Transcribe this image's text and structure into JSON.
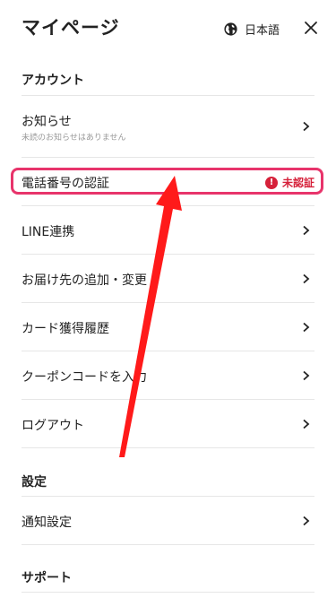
{
  "header": {
    "title": "マイページ",
    "language_label": "日本語",
    "globe_icon": "globe-icon",
    "close_icon": "close-icon"
  },
  "sections": {
    "account": "アカウント",
    "settings": "設定",
    "support": "サポート"
  },
  "menu": {
    "notifications": {
      "label": "お知らせ",
      "sub": "未読のお知らせはありません"
    },
    "phone_verify": {
      "label": "電話番号の認証",
      "status": "未認証"
    },
    "line_link": {
      "label": "LINE連携"
    },
    "address": {
      "label": "お届け先の追加・変更"
    },
    "card_history": {
      "label": "カード獲得履歴"
    },
    "coupon": {
      "label": "クーポンコードを入力"
    },
    "logout": {
      "label": "ログアウト"
    },
    "notify_settings": {
      "label": "通知設定"
    }
  },
  "colors": {
    "highlight": "#e8346b",
    "status": "#d6213a",
    "arrow": "#ff1a1a"
  }
}
